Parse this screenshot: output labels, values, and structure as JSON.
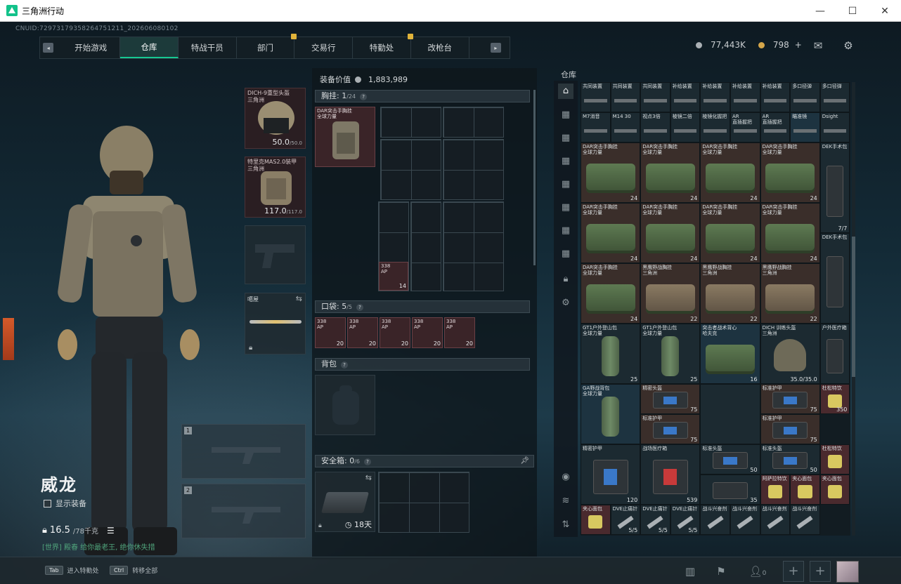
{
  "window": {
    "title": "三角洲行动",
    "min": "—",
    "max": "☐",
    "close": "✕"
  },
  "cnuid": "CNUID:7297317935826475121​1_202606080102",
  "nav": {
    "left_key": "◂",
    "right_key": "▸",
    "tabs": [
      "开始游戏",
      "仓库",
      "特战干员",
      "部门",
      "交易行",
      "特勤处",
      "改枪台"
    ],
    "active": "仓库"
  },
  "currency": {
    "coins": "77,443K",
    "tickets": "798",
    "plus": "+"
  },
  "equip": {
    "helmet": {
      "label": "DICH-9重型头盔\n三角洲",
      "value": "50.0",
      "max": "/50.0"
    },
    "armor": {
      "label": "特里克MAS2.0装甲\n三角洲",
      "value": "117.0",
      "max": "/117.0"
    },
    "melee": {
      "label": "噶屋"
    },
    "gun1": "1",
    "gun2": "2"
  },
  "player": {
    "name": "威龙",
    "show_equip": "显示装备",
    "weight": "16.5",
    "weight_max": "/78千克",
    "chat": "[世界] 殿春 给你最老王, 绝你休失措"
  },
  "mid": {
    "value_label": "装备价值",
    "value": "1,883,989",
    "chest": {
      "label": "胸挂:",
      "count": "1",
      "max": "/24"
    },
    "chest_item": "DAR突击手胸挂\n全球力量",
    "chest_small": {
      "label": "338\nAP",
      "count": "14"
    },
    "pocket": {
      "label": "口袋:",
      "count": "5",
      "max": "/5"
    },
    "pocket_items": [
      {
        "label": "338\nAP",
        "count": "20"
      },
      {
        "label": "338\nAP",
        "count": "20"
      },
      {
        "label": "338\nAP",
        "count": "20"
      },
      {
        "label": "338\nAP",
        "count": "20"
      },
      {
        "label": "338\nAP",
        "count": "20"
      }
    ],
    "backpack": {
      "label": "背包"
    },
    "safe": {
      "label": "安全箱:",
      "count": "0",
      "max": "/6",
      "days": "18天"
    }
  },
  "warehouse": {
    "title": "仓库",
    "row1": [
      "共同装置",
      "共同装置",
      "共同装置",
      "补给装置",
      "补给装置",
      "补给装置",
      "补给装置",
      "多口径弹",
      "多口径弹"
    ],
    "row2": [
      "M7消音",
      "M14 30",
      "视点3倍",
      "棱镜二倍",
      "棱镜化握把",
      "AR\n直插握把",
      "AR\n直插握把",
      "瞄准镜",
      "Dsight"
    ],
    "bags": [
      "DAR突击手胸挂\n全球力量",
      "DAR突击手胸挂\n全球力量",
      "DAR突击手胸挂\n全球力量",
      "DAR突击手胸挂\n全球力量"
    ],
    "bags_row3": [
      "DAR突击手胸挂\n全球力量",
      "黑鹰野战胸挂\n三角洲",
      "黑鹰野战胸挂\n三角洲",
      "黑鹰野战胸挂\n三角洲"
    ],
    "bag_count": "24",
    "bag_count2": "22",
    "dek": "DEK手术包",
    "dek_count": "7/7",
    "row5": [
      "GT1户外登山包\n全球力量",
      "GT1户外登山包\n全球力量",
      "突击者战术背心\n哈夫克",
      "DICH 训练头盔\n三角洲",
      "户外医疗箱"
    ],
    "row5_counts": [
      "25",
      "25",
      "16",
      "35.0/35.0"
    ],
    "ga": "GA野战背包\n全球力量",
    "med": [
      "精密头盔",
      "标准护甲",
      "标准护甲",
      "标准护甲",
      "杜松特饮"
    ],
    "med_counts": [
      "75",
      "75",
      "75",
      "75",
      "350"
    ],
    "row7": [
      "精密护甲",
      "战场医疗箱",
      "标准头盔",
      "标准头盔",
      "杜松特饮"
    ],
    "row7_counts": [
      "120",
      "539",
      "50",
      "50"
    ],
    "row8": [
      "阿萨拉特饮",
      "夹心面包",
      "夹心面包"
    ],
    "row8_count": "35",
    "last": [
      "夹心面包",
      "DVE止痛针",
      "DVE止痛针",
      "DVE止痛针",
      "战斗兴奋剂",
      "战斗兴奋剂",
      "战斗兴奋剂",
      "战斗兴奋剂"
    ],
    "last_count": "5/5"
  },
  "bottom": {
    "tab_key": "Tab",
    "tab_text": "进入特勤处",
    "ctrl_key": "Ctrl",
    "ctrl_text": "转移全部",
    "friends": "0"
  },
  "colors": {
    "accent": "#17c892",
    "warn": "#e0b33a"
  }
}
